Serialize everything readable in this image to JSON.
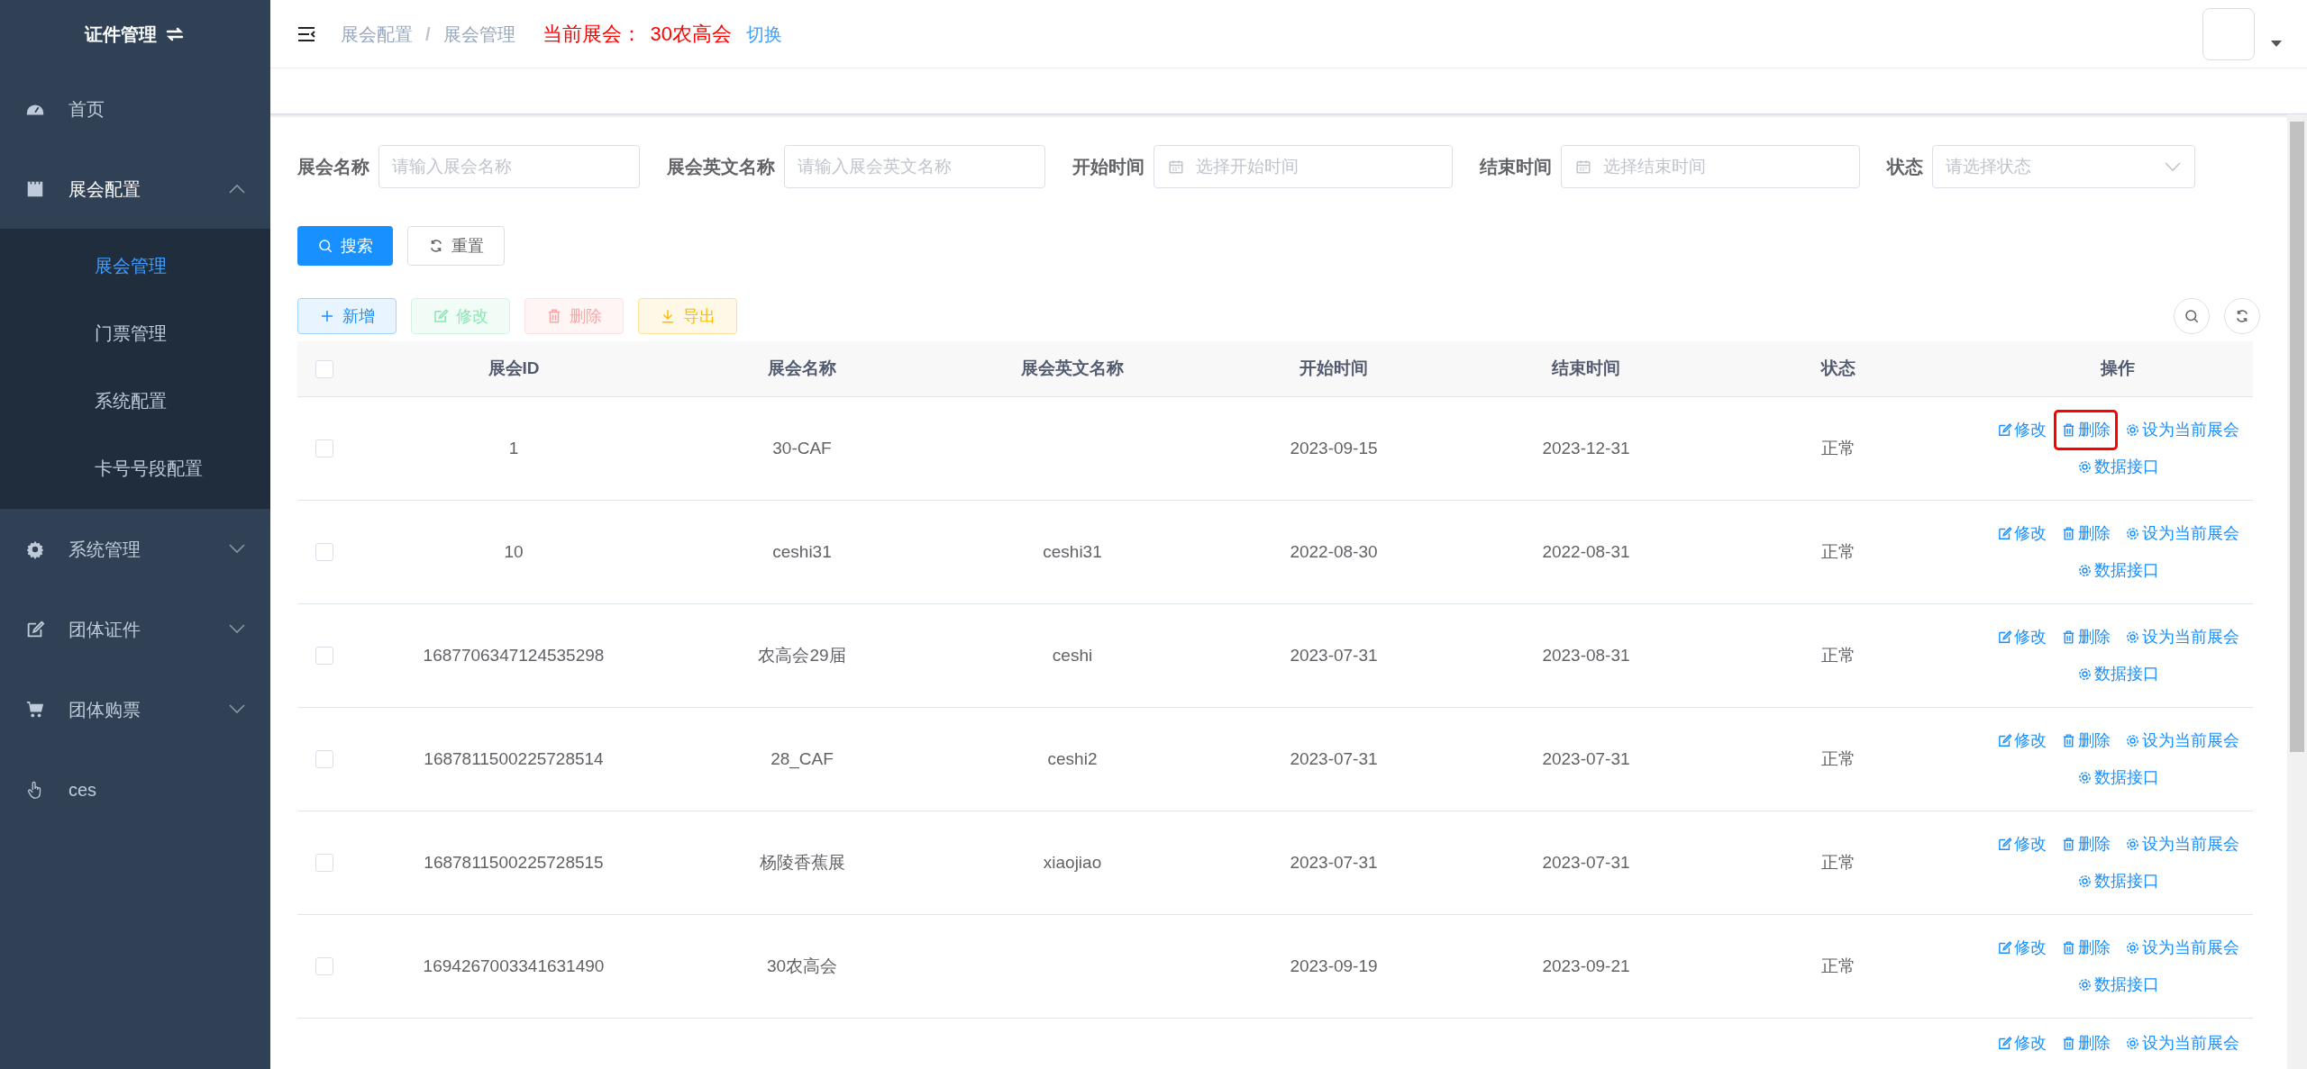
{
  "sidebar": {
    "title": "证件管理",
    "items": [
      {
        "label": "首页",
        "kind": "link"
      },
      {
        "label": "展会配置",
        "kind": "submenu",
        "expanded": true,
        "children": [
          {
            "label": "展会管理",
            "selected": true
          },
          {
            "label": "门票管理",
            "selected": false
          },
          {
            "label": "系统配置",
            "selected": false
          },
          {
            "label": "卡号号段配置",
            "selected": false
          }
        ]
      },
      {
        "label": "系统管理",
        "kind": "submenu",
        "expanded": false
      },
      {
        "label": "团体证件",
        "kind": "submenu",
        "expanded": false
      },
      {
        "label": "团体购票",
        "kind": "submenu",
        "expanded": false
      },
      {
        "label": "ces",
        "kind": "link"
      }
    ]
  },
  "header": {
    "breadcrumb": [
      "展会配置",
      "展会管理"
    ],
    "breadcrumb_separator": "/",
    "current_label": "当前展会：",
    "current_value": "30农高会",
    "switch_link": "切换"
  },
  "filters": [
    {
      "label": "展会名称",
      "kind": "text",
      "placeholder": "请输入展会名称"
    },
    {
      "label": "展会英文名称",
      "kind": "text",
      "placeholder": "请输入展会英文名称"
    },
    {
      "label": "开始时间",
      "kind": "date",
      "placeholder": "选择开始时间"
    },
    {
      "label": "结束时间",
      "kind": "date",
      "placeholder": "选择结束时间"
    },
    {
      "label": "状态",
      "kind": "select",
      "placeholder": "请选择状态"
    }
  ],
  "search_buttons": [
    {
      "label": "搜索",
      "kind": "search"
    },
    {
      "label": "重置",
      "kind": "reset"
    }
  ],
  "toolbar": [
    {
      "label": "新增",
      "kind": "add",
      "disabled": false
    },
    {
      "label": "修改",
      "kind": "edit",
      "disabled": true
    },
    {
      "label": "删除",
      "kind": "delete",
      "disabled": true
    },
    {
      "label": "导出",
      "kind": "export",
      "disabled": false
    }
  ],
  "table": {
    "select_all": {
      "checked": false
    },
    "columns": [
      "展会ID",
      "展会名称",
      "展会英文名称",
      "开始时间",
      "结束时间",
      "状态",
      "操作"
    ],
    "rows": [
      {
        "checked": false,
        "cells": [
          "1",
          "30-CAF",
          "",
          "2023-09-15",
          "2023-12-31",
          "正常"
        ],
        "actions": [
          {
            "label": "修改",
            "kind": "edit",
            "highlighted": false
          },
          {
            "label": "删除",
            "kind": "delete",
            "highlighted": true
          },
          {
            "label": "设为当前展会",
            "kind": "set",
            "highlighted": false
          },
          {
            "label": "数据接口",
            "kind": "api",
            "highlighted": false
          }
        ]
      },
      {
        "checked": false,
        "cells": [
          "10",
          "ceshi31",
          "ceshi31",
          "2022-08-30",
          "2022-08-31",
          "正常"
        ],
        "actions": [
          {
            "label": "修改",
            "kind": "edit",
            "highlighted": false
          },
          {
            "label": "删除",
            "kind": "delete",
            "highlighted": false
          },
          {
            "label": "设为当前展会",
            "kind": "set",
            "highlighted": false
          },
          {
            "label": "数据接口",
            "kind": "api",
            "highlighted": false
          }
        ]
      },
      {
        "checked": false,
        "cells": [
          "1687706347124535298",
          "农高会29届",
          "ceshi",
          "2023-07-31",
          "2023-08-31",
          "正常"
        ],
        "actions": [
          {
            "label": "修改",
            "kind": "edit",
            "highlighted": false
          },
          {
            "label": "删除",
            "kind": "delete",
            "highlighted": false
          },
          {
            "label": "设为当前展会",
            "kind": "set",
            "highlighted": false
          },
          {
            "label": "数据接口",
            "kind": "api",
            "highlighted": false
          }
        ]
      },
      {
        "checked": false,
        "cells": [
          "1687811500225728514",
          "28_CAF",
          "ceshi2",
          "2023-07-31",
          "2023-07-31",
          "正常"
        ],
        "actions": [
          {
            "label": "修改",
            "kind": "edit",
            "highlighted": false
          },
          {
            "label": "删除",
            "kind": "delete",
            "highlighted": false
          },
          {
            "label": "设为当前展会",
            "kind": "set",
            "highlighted": false
          },
          {
            "label": "数据接口",
            "kind": "api",
            "highlighted": false
          }
        ]
      },
      {
        "checked": false,
        "cells": [
          "1687811500225728515",
          "杨陵香蕉展",
          "xiaojiao",
          "2023-07-31",
          "2023-07-31",
          "正常"
        ],
        "actions": [
          {
            "label": "修改",
            "kind": "edit",
            "highlighted": false
          },
          {
            "label": "删除",
            "kind": "delete",
            "highlighted": false
          },
          {
            "label": "设为当前展会",
            "kind": "set",
            "highlighted": false
          },
          {
            "label": "数据接口",
            "kind": "api",
            "highlighted": false
          }
        ]
      },
      {
        "checked": false,
        "cells": [
          "1694267003341631490",
          "30农高会",
          "",
          "2023-09-19",
          "2023-09-21",
          "正常"
        ],
        "actions": [
          {
            "label": "修改",
            "kind": "edit",
            "highlighted": false
          },
          {
            "label": "删除",
            "kind": "delete",
            "highlighted": false
          },
          {
            "label": "设为当前展会",
            "kind": "set",
            "highlighted": false
          },
          {
            "label": "数据接口",
            "kind": "api",
            "highlighted": false
          }
        ]
      },
      {
        "cells": [],
        "actions": [
          {
            "label": "修改",
            "kind": "edit",
            "highlighted": false
          },
          {
            "label": "删除",
            "kind": "delete",
            "highlighted": false
          },
          {
            "label": "设为当前展会",
            "kind": "set",
            "highlighted": false
          }
        ]
      }
    ]
  }
}
